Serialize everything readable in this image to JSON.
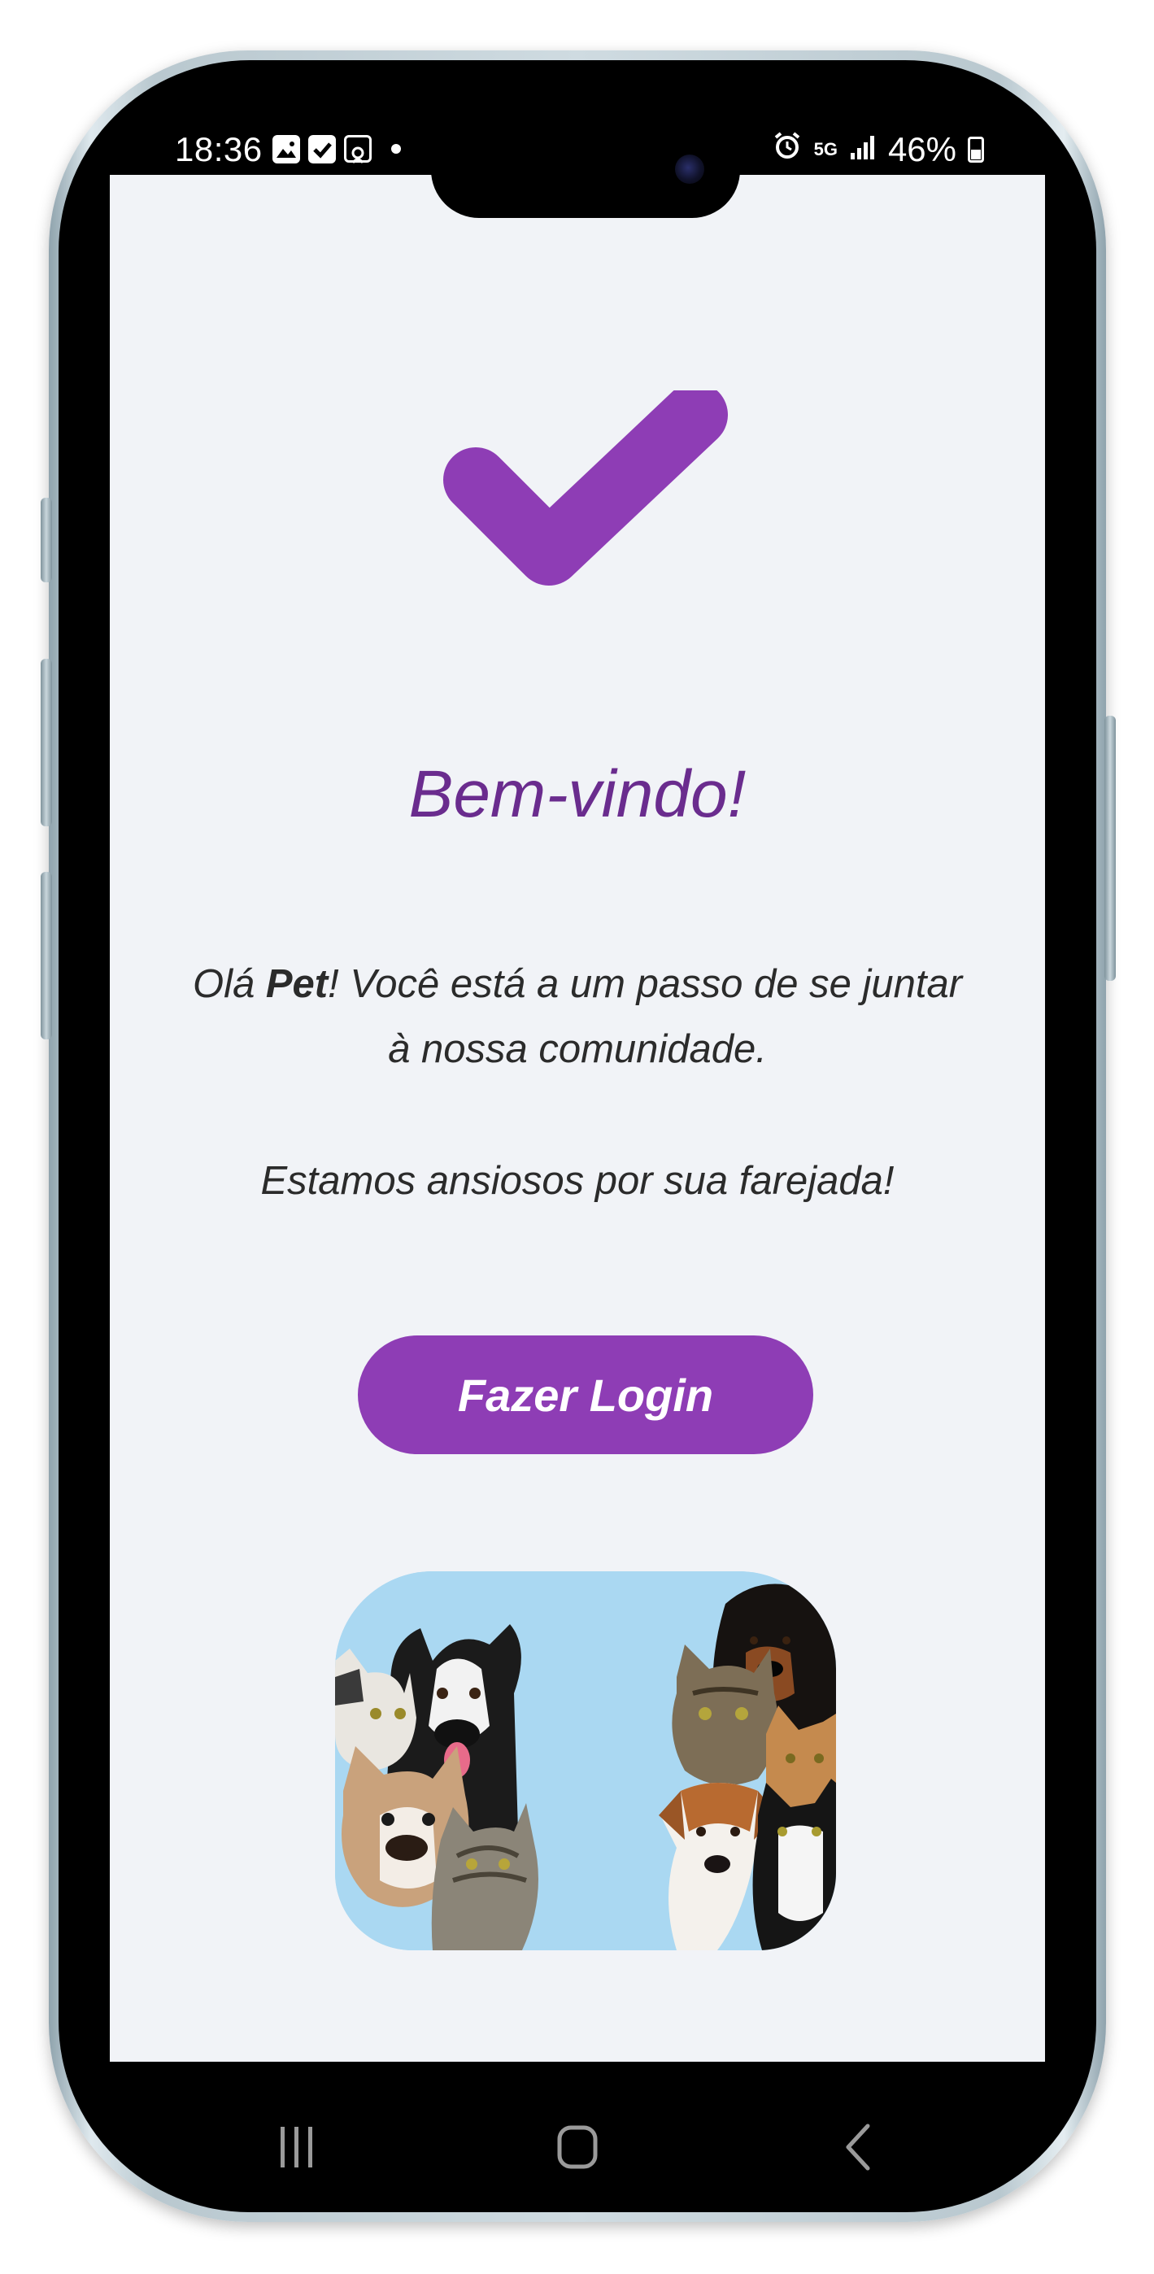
{
  "status_bar": {
    "time": "18:36",
    "network": "5G",
    "battery_percent": "46%"
  },
  "main": {
    "title": "Bem-vindo!",
    "greeting_prefix": "Olá ",
    "user_name": "Pet",
    "greeting_suffix": "! Você está a um passo de se juntar à nossa comunidade.",
    "tagline": "Estamos ansiosos por sua farejada!",
    "login_button_label": "Fazer Login"
  },
  "icons": {
    "hero": "checkmark-icon",
    "nav_recent": "recent-apps-icon",
    "nav_home": "home-icon",
    "nav_back": "back-icon"
  },
  "colors": {
    "accent": "#8e3db5",
    "title": "#6a2c8e",
    "background": "#f1f3f7",
    "image_background": "#aad8f2"
  }
}
